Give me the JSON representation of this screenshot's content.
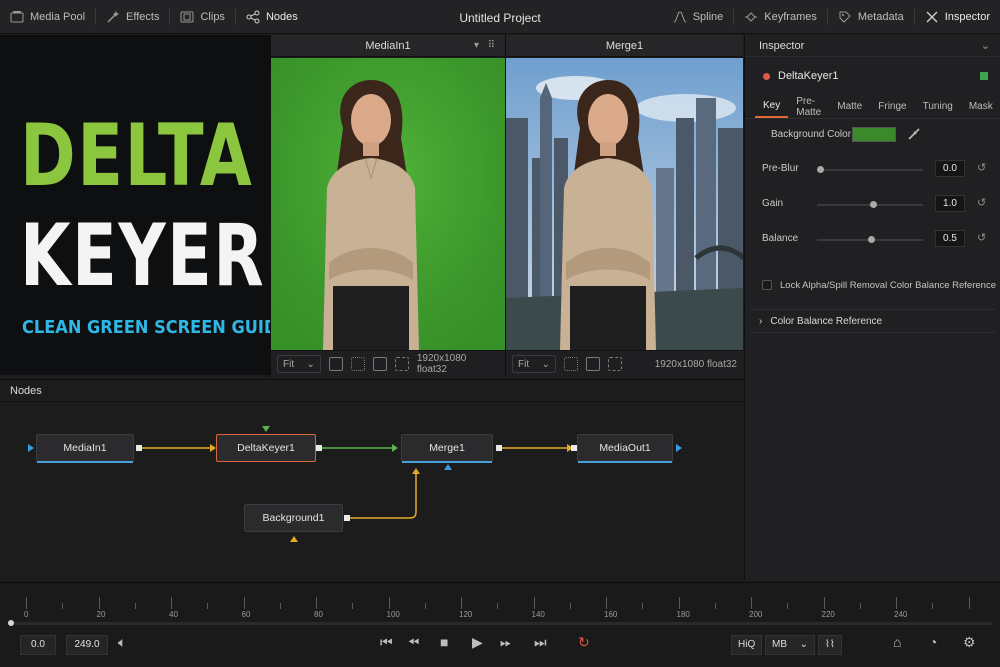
{
  "app": {
    "title": "Untitled Project"
  },
  "toolbar": {
    "left": [
      {
        "label": "Media Pool",
        "icon": "media-pool-icon"
      },
      {
        "label": "Effects",
        "icon": "effects-icon"
      },
      {
        "label": "Clips",
        "icon": "clips-icon"
      },
      {
        "label": "Nodes",
        "icon": "nodes-icon",
        "active": true
      }
    ],
    "right": [
      {
        "label": "Spline",
        "icon": "spline-icon"
      },
      {
        "label": "Keyframes",
        "icon": "keyframes-icon"
      },
      {
        "label": "Metadata",
        "icon": "metadata-icon"
      },
      {
        "label": "Inspector",
        "icon": "inspector-icon",
        "active": true
      }
    ]
  },
  "thumbnail": {
    "line1": "DELTA",
    "line2": "KEYER",
    "line3": "CLEAN GREEN SCREEN GUIDE"
  },
  "viewer_left": {
    "title": "MediaIn1",
    "fit": "Fit",
    "resolution": "1920x1080 float32"
  },
  "viewer_right": {
    "title": "Merge1",
    "fit": "Fit",
    "resolution": "1920x1080 float32"
  },
  "inspector": {
    "header": "Inspector",
    "node_name": "DeltaKeyer1",
    "tabs": [
      "Key",
      "Pre-Matte",
      "Matte",
      "Fringe",
      "Tuning",
      "Mask"
    ],
    "background_color_label": "Background Color",
    "background_color": "#3a8a2c",
    "params": [
      {
        "label": "Pre-Blur",
        "value": "0.0",
        "level": 0.0
      },
      {
        "label": "Gain",
        "value": "1.0",
        "level": 0.5
      },
      {
        "label": "Balance",
        "value": "0.5",
        "level": 0.48
      }
    ],
    "lock_label": "Lock Alpha/Spill Removal Color Balance Reference",
    "color_balance_label": "Color Balance Reference"
  },
  "nodes_panel": {
    "header": "Nodes",
    "nodes": [
      "MediaIn1",
      "DeltaKeyer1",
      "Merge1",
      "MediaOut1",
      "Background1"
    ]
  },
  "timeline": {
    "ticks": [
      "0",
      "20",
      "40",
      "60",
      "80",
      "100",
      "120",
      "140",
      "160",
      "180",
      "200",
      "220",
      "240"
    ],
    "current_time": "0.0",
    "end_time": "249.0",
    "hiq": "HiQ",
    "mb": "MB"
  }
}
